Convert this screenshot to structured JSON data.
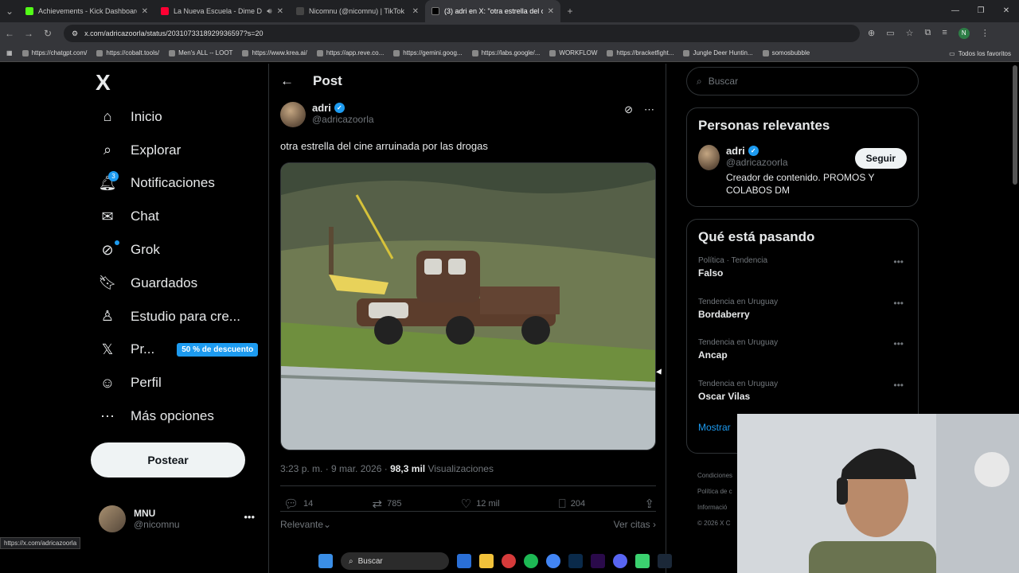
{
  "browser": {
    "tabs": [
      {
        "title": "Achievements - Kick Dashboard",
        "color": "#53fc18"
      },
      {
        "title": "La Nueva Escuela - Dime D",
        "color": "#ff0033"
      },
      {
        "title": "Nicomnu (@nicomnu) | TikTok",
        "color": "#222222"
      },
      {
        "title": "(3) adri en X: \"otra estrella del c",
        "color": "#111111"
      }
    ],
    "url": "x.com/adricazoorla/status/2031073318929936597?s=20",
    "bookmarks": [
      "https://chatgpt.com/",
      "https://cobalt.tools/",
      "Men's ALL -- LOOT",
      "https://www.krea.ai/",
      "https://app.reve.co...",
      "https://gemini.goog...",
      "https://labs.google/...",
      "WORKFLOW",
      "https://bracketfight...",
      "Jungle Deer Huntin...",
      "somosbubble"
    ],
    "all_bookmarks": "Todos los favoritos",
    "status_url": "https://x.com/adricazoorla"
  },
  "nav": {
    "logo": "X",
    "items": [
      {
        "label": "Inicio",
        "icon": "home-icon",
        "glyph": "⌂"
      },
      {
        "label": "Explorar",
        "icon": "search-icon",
        "glyph": "⌕"
      },
      {
        "label": "Notificaciones",
        "icon": "bell-icon",
        "glyph": "🔔︎"
      },
      {
        "label": "Chat",
        "icon": "mail-icon",
        "glyph": "✉"
      },
      {
        "label": "Grok",
        "icon": "grok-icon",
        "glyph": "⊘"
      },
      {
        "label": "Guardados",
        "icon": "bookmark-icon",
        "glyph": "🔖︎"
      },
      {
        "label": "Estudio para cre...",
        "icon": "studio-icon",
        "glyph": "♙"
      },
      {
        "label": "Pr...",
        "icon": "x-premium-icon",
        "glyph": "𝕏"
      },
      {
        "label": "Perfil",
        "icon": "profile-icon",
        "glyph": "☺"
      },
      {
        "label": "Más opciones",
        "icon": "more-icon",
        "glyph": "⋯"
      }
    ],
    "notif_count": "3",
    "promo": "50 % de descuento",
    "post_button": "Postear",
    "account": {
      "name": "MNU",
      "handle": "@nicomnu"
    }
  },
  "main": {
    "header": "Post",
    "author": {
      "name": "adri",
      "handle": "@adricazoorla"
    },
    "text": "otra estrella del cine arruinada por las drogas",
    "time": "3:23 p. m. · 9 mar. 2026 · ",
    "views": "98,3 mil",
    "views_label": " Visualizaciones",
    "stats": {
      "replies": "14",
      "reposts": "785",
      "likes": "12 mil",
      "bookmarks": "204"
    },
    "sort": "Relevante",
    "quotes": "Ver citas"
  },
  "right": {
    "search_placeholder": "Buscar",
    "relevant_title": "Personas relevantes",
    "relevant": {
      "name": "adri",
      "handle": "@adricazoorla",
      "bio": "Creador de contenido. PROMOS Y COLABOS DM",
      "follow": "Seguir"
    },
    "trends_title": "Qué está pasando",
    "trends": [
      {
        "context": "Política · Tendencia",
        "name": "Falso"
      },
      {
        "context": "Tendencia en Uruguay",
        "name": "Bordaberry"
      },
      {
        "context": "Tendencia en Uruguay",
        "name": "Ancap"
      },
      {
        "context": "Tendencia en Uruguay",
        "name": "Oscar Vilas"
      }
    ],
    "show_more": "Mostrar",
    "footer": [
      "Condiciones",
      "Política de c",
      "Informació",
      "© 2026 X C"
    ]
  },
  "taskbar": {
    "search": "Buscar"
  }
}
